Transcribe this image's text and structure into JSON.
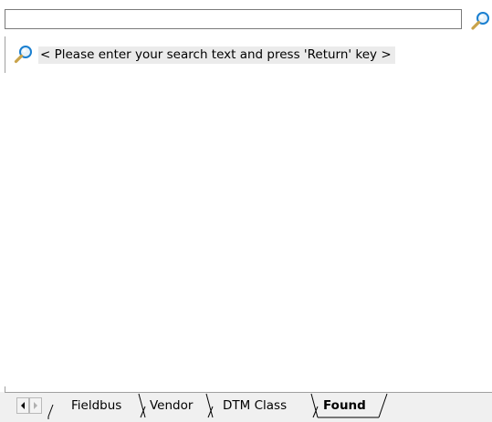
{
  "search": {
    "value": "",
    "placeholder": ""
  },
  "hint": {
    "text": "< Please enter your search text and press 'Return' key >"
  },
  "tabs": [
    {
      "label": "Fieldbus",
      "active": false
    },
    {
      "label": "Vendor",
      "active": false
    },
    {
      "label": "DTM Class",
      "active": false
    },
    {
      "label": "Found",
      "active": true
    }
  ],
  "icons": {
    "search_button": "magnifier-icon",
    "hint": "magnifier-icon",
    "scroll_left": "triangle-left-icon",
    "scroll_right": "triangle-right-icon"
  },
  "colors": {
    "magnifier_ring": "#1a7fd0",
    "magnifier_handle": "#c9a34a"
  }
}
